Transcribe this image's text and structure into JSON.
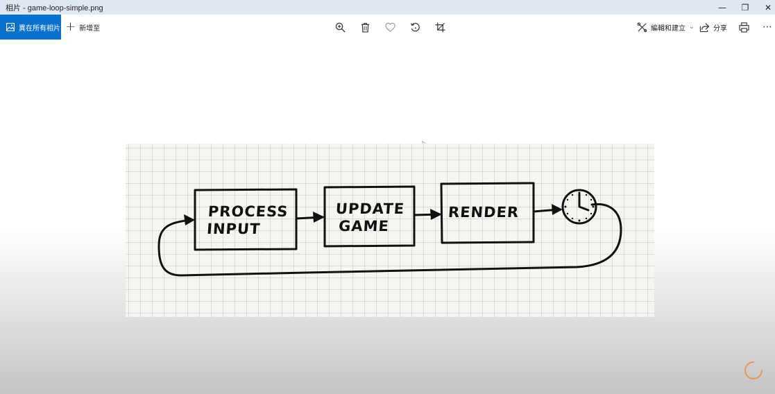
{
  "window": {
    "title": "相片 - game-loop-simple.png",
    "controls": {
      "minimize": "—",
      "restore": "❐",
      "close": "✕"
    }
  },
  "toolbar": {
    "all_photos_label": "異在所有相片",
    "add_to_label": "新增至",
    "edit_create_label": "編輯和建立",
    "share_label": "分享",
    "more_label": "⋯"
  },
  "diagram": {
    "boxes": [
      {
        "id": "process-input",
        "lines": [
          "PROCESS",
          "INPUT"
        ]
      },
      {
        "id": "update-game",
        "lines": [
          "UPDATE",
          "GAME"
        ]
      },
      {
        "id": "render",
        "lines": [
          "RENDER"
        ]
      }
    ]
  },
  "colors": {
    "accent": "#0a72cc",
    "titlebar": "#dfe8f2",
    "spinner": "#f08a52"
  }
}
